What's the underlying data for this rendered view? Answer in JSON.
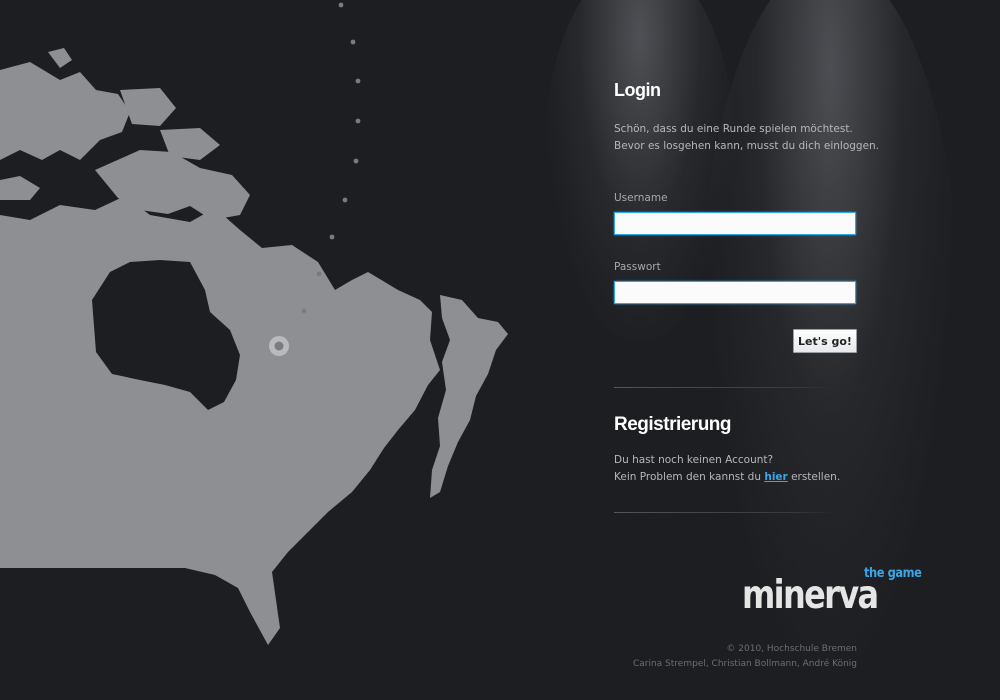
{
  "login": {
    "title": "Login",
    "intro_line1": "Schön, dass du eine Runde spielen möchtest.",
    "intro_line2": "Bevor es losgehen kann, musst du dich einloggen.",
    "username_label": "Username",
    "username_value": "",
    "password_label": "Passwort",
    "password_value": "",
    "submit_label": "Let's go!"
  },
  "registration": {
    "title": "Registrierung",
    "line1": "Du hast noch keinen Account?",
    "line2_before": "Kein Problem den kannst du",
    "link_label": "hier",
    "line2_after": "erstellen."
  },
  "logo": {
    "name": "minerva",
    "tagline": "the game"
  },
  "footer": {
    "copyright": "© 2010, Hochschule Bremen",
    "authors": "Carina Strempel, Christian Bollmann, André König"
  },
  "colors": {
    "background": "#1d1e21",
    "map": "#8e8f93",
    "accent": "#3aa6e8",
    "input_border": "#2fa7e3"
  }
}
